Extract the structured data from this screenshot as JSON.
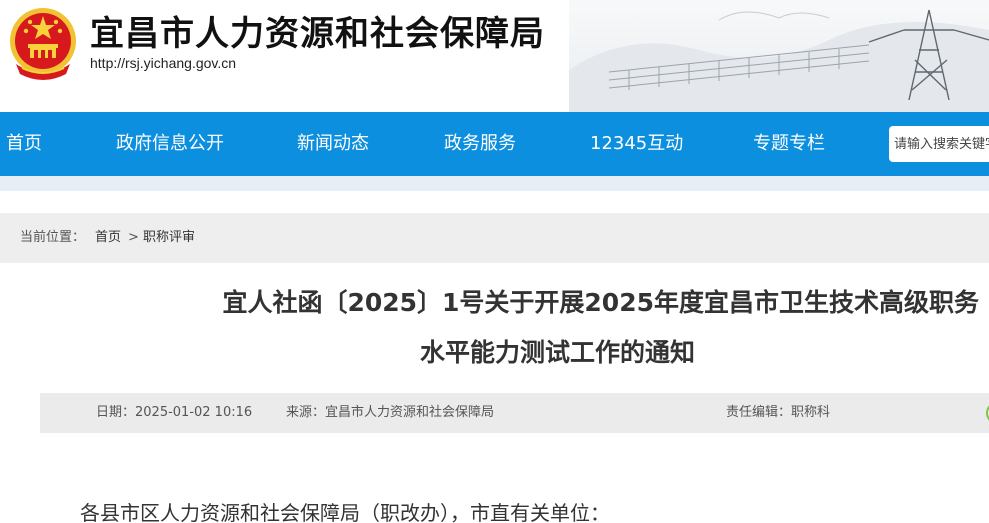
{
  "site": {
    "title": "宜昌市人力资源和社会保障局",
    "url": "http://rsj.yichang.gov.cn"
  },
  "nav": {
    "items": [
      {
        "label": "首页"
      },
      {
        "label": "政府信息公开"
      },
      {
        "label": "新闻动态"
      },
      {
        "label": "政务服务"
      },
      {
        "label": "12345互动"
      },
      {
        "label": "专题专栏"
      }
    ],
    "search_placeholder": "请输入搜索关键字"
  },
  "breadcrumb": {
    "prefix": "当前位置：",
    "home": "首页",
    "separator": ">",
    "current": "职称评审"
  },
  "article": {
    "title_line1": "宜人社函〔2025〕1号关于开展2025年度宜昌市卫生技术高级职务",
    "title_line2": "水平能力测试工作的通知",
    "date": "日期：2025-01-02 10:16",
    "source": "来源：宜昌市人力资源和社会保障局",
    "editor": "责任编辑：职称科",
    "salutation": "各县市区人力资源和社会保障局（职改办），市直有关单位："
  },
  "colors": {
    "nav_bg": "#0d8fe0",
    "emblem_red": "#d7191e",
    "emblem_gold": "#f7c72a"
  },
  "icons": [
    "national-emblem-icon",
    "share-icon"
  ]
}
